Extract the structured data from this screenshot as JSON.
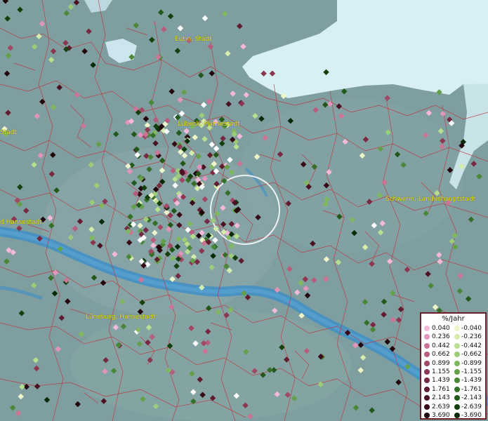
{
  "cities": [
    {
      "id": "eutin",
      "label": "Eutin, Stadt"
    },
    {
      "id": "luebeck",
      "label": "Lübeck, Hansestadt"
    },
    {
      "id": "stadt_left",
      "label": "Stadt"
    },
    {
      "id": "hansestadt_left",
      "label": "d Hansestadt"
    },
    {
      "id": "schwerin",
      "label": "Schwerin, Landeshauptstadt"
    },
    {
      "id": "lueneburg",
      "label": "Lüneburg, Hansestadt"
    }
  ],
  "legend": {
    "title": "%/Jahr",
    "positive": [
      {
        "value": "0.040",
        "color": "#f4b8d8"
      },
      {
        "value": "0.236",
        "color": "#e294ba"
      },
      {
        "value": "0.442",
        "color": "#cc7496"
      },
      {
        "value": "0.662",
        "color": "#b65c7c"
      },
      {
        "value": "0.899",
        "color": "#a04864"
      },
      {
        "value": "1.155",
        "color": "#8c3650"
      },
      {
        "value": "1.439",
        "color": "#782840"
      },
      {
        "value": "1.761",
        "color": "#621c30"
      },
      {
        "value": "2.143",
        "color": "#4c1222"
      },
      {
        "value": "2.639",
        "color": "#380a16"
      },
      {
        "value": "3.690",
        "color": "#22040a"
      }
    ],
    "negative": [
      {
        "value": "-0.040",
        "color": "#eef6c8"
      },
      {
        "value": "-0.236",
        "color": "#d4ecac"
      },
      {
        "value": "-0.442",
        "color": "#b8de90"
      },
      {
        "value": "-0.662",
        "color": "#9ccc78"
      },
      {
        "value": "-0.899",
        "color": "#80b860"
      },
      {
        "value": "-1.155",
        "color": "#64a04a"
      },
      {
        "value": "-1.439",
        "color": "#4a8838"
      },
      {
        "value": "-1.761",
        "color": "#347028"
      },
      {
        "value": "-2.143",
        "color": "#22581a"
      },
      {
        "value": "-2.639",
        "color": "#14400e"
      },
      {
        "value": "-3.690",
        "color": "#082a06"
      }
    ]
  },
  "colors": {
    "land": "#7f9ea0",
    "sea": "#d8eff3",
    "river": "#3f8fc6",
    "borders": "#c0303a",
    "city_label": "#f2e200",
    "highlight_circle": "#ffffff"
  }
}
